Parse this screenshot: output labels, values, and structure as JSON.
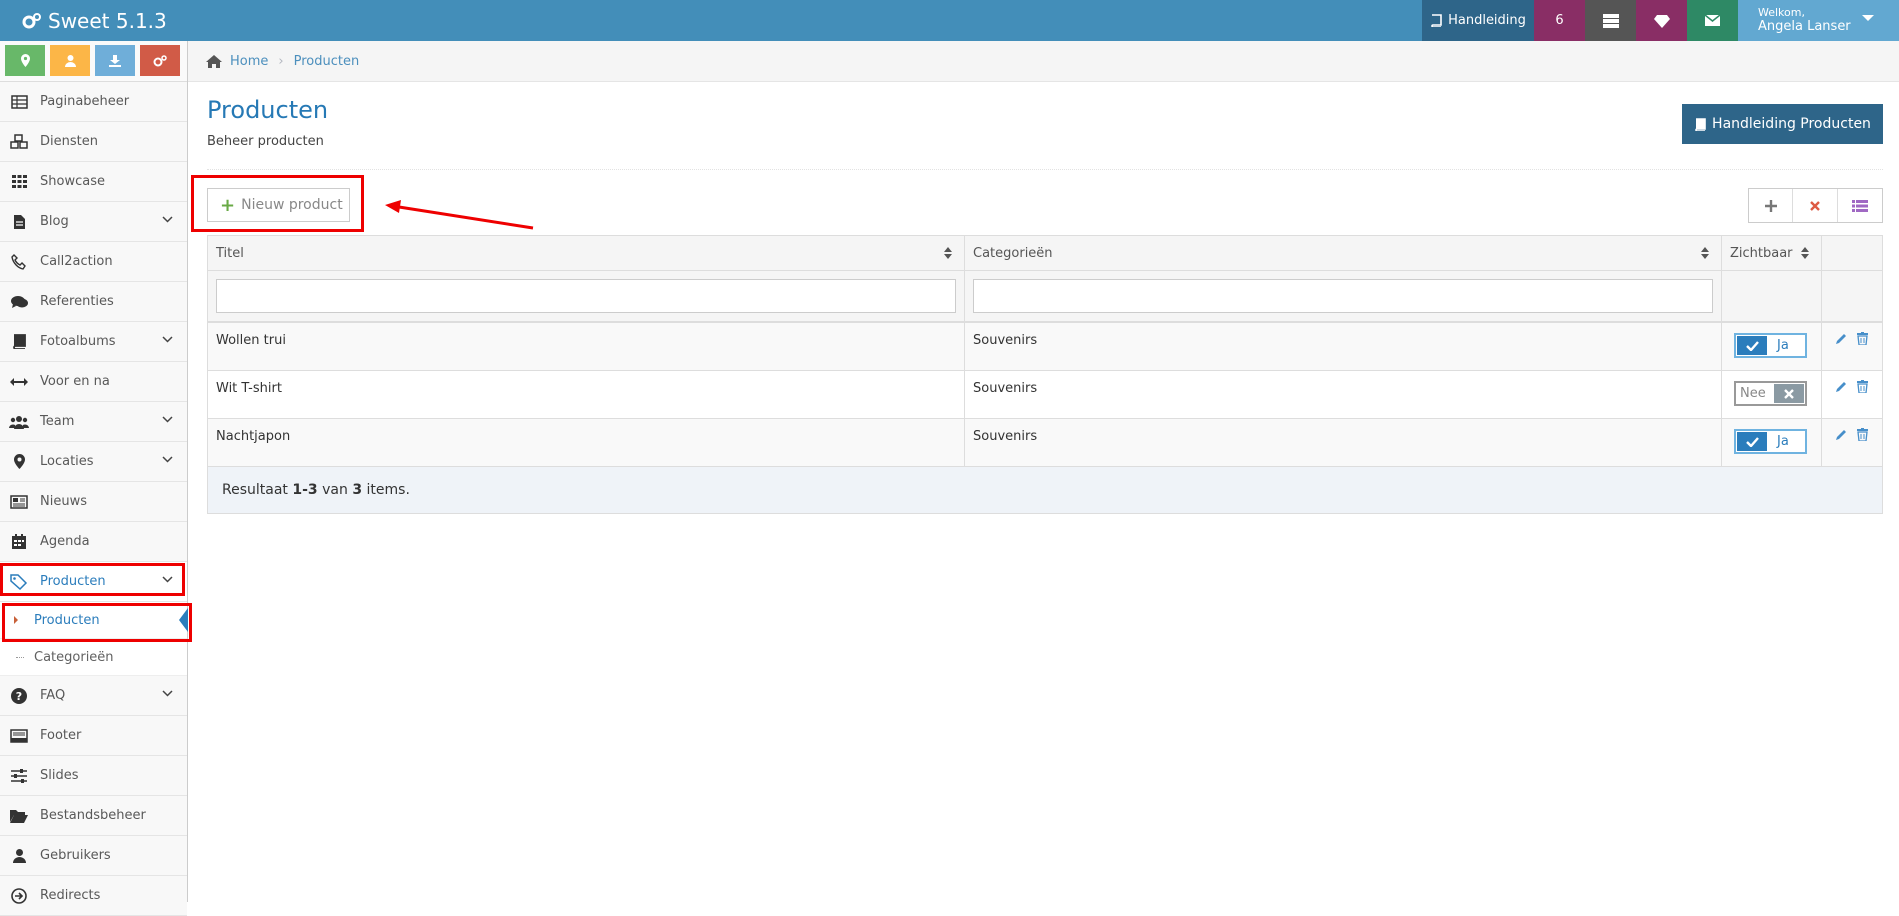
{
  "app": {
    "title": "Sweet 5.1.3"
  },
  "navbar": {
    "manual_label": "Handleiding",
    "notification_count": "6",
    "welcome": "Welkom,",
    "user_name": "Angela Lanser"
  },
  "colors": {
    "navbar": "#438eb9",
    "accent": "#2679b5",
    "highlight": "#ee0000"
  },
  "sidebar": {
    "items": [
      {
        "label": "Paginabeheer",
        "icon": "table-icon"
      },
      {
        "label": "Diensten",
        "icon": "cubes-icon"
      },
      {
        "label": "Showcase",
        "icon": "grid-icon"
      },
      {
        "label": "Blog",
        "icon": "file-icon"
      },
      {
        "label": "Call2action",
        "icon": "phone-icon"
      },
      {
        "label": "Referenties",
        "icon": "comments-icon"
      },
      {
        "label": "Fotoalbums",
        "icon": "book-icon"
      },
      {
        "label": "Voor en na",
        "icon": "arrows-h-icon"
      },
      {
        "label": "Team",
        "icon": "users-icon"
      },
      {
        "label": "Locaties",
        "icon": "map-marker-icon"
      },
      {
        "label": "Nieuws",
        "icon": "newspaper-icon"
      },
      {
        "label": "Agenda",
        "icon": "calendar-icon"
      },
      {
        "label": "Producten",
        "icon": "tags-icon"
      },
      {
        "label": "FAQ",
        "icon": "question-icon"
      },
      {
        "label": "Footer",
        "icon": "footer-icon"
      },
      {
        "label": "Slides",
        "icon": "sliders-icon"
      },
      {
        "label": "Bestandsbeheer",
        "icon": "folder-icon"
      },
      {
        "label": "Gebruikers",
        "icon": "user-icon"
      },
      {
        "label": "Redirects",
        "icon": "redirect-icon"
      }
    ],
    "sub_items": [
      {
        "label": "Producten"
      },
      {
        "label": "Categorieën"
      }
    ]
  },
  "breadcrumb": {
    "home": "Home",
    "current": "Producten"
  },
  "page": {
    "title": "Producten",
    "subtitle": "Beheer producten",
    "manual_button": "Handleiding Producten",
    "new_button": "Nieuw product"
  },
  "table": {
    "columns": [
      "Titel",
      "Categorieën",
      "Zichtbaar"
    ],
    "rows": [
      {
        "title": "Wollen trui",
        "category": "Souvenirs",
        "visible": "Ja"
      },
      {
        "title": "Wit T-shirt",
        "category": "Souvenirs",
        "visible": "Nee"
      },
      {
        "title": "Nachtjapon",
        "category": "Souvenirs",
        "visible": "Ja"
      }
    ],
    "footer": {
      "prefix": "Resultaat",
      "range": "1-3",
      "of": "van",
      "total": "3",
      "suffix": "items."
    }
  }
}
